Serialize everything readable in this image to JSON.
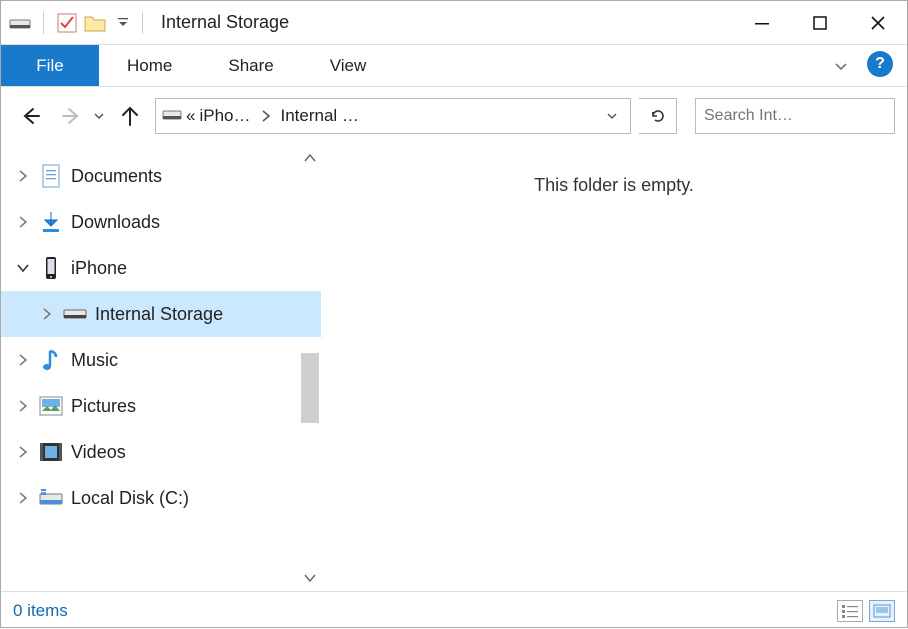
{
  "title": "Internal Storage",
  "ribbon": {
    "file": "File",
    "tabs": [
      "Home",
      "Share",
      "View"
    ]
  },
  "address": {
    "root_symbol": "«",
    "crumbs": [
      "iPho…",
      "Internal …"
    ]
  },
  "search": {
    "placeholder": "Search Int…"
  },
  "tree": [
    {
      "label": "Documents",
      "icon": "document",
      "expander": ">"
    },
    {
      "label": "Downloads",
      "icon": "download",
      "expander": ">"
    },
    {
      "label": "iPhone",
      "icon": "phone",
      "expander": "v",
      "expanded": true
    },
    {
      "label": "Internal Storage",
      "icon": "drive",
      "expander": ">",
      "child": true,
      "selected": true
    },
    {
      "label": "Music",
      "icon": "music",
      "expander": ">"
    },
    {
      "label": "Pictures",
      "icon": "pictures",
      "expander": ">"
    },
    {
      "label": "Videos",
      "icon": "videos",
      "expander": ">"
    },
    {
      "label": "Local Disk (C:)",
      "icon": "localdisk",
      "expander": ">"
    }
  ],
  "content": {
    "empty_message": "This folder is empty."
  },
  "status": {
    "item_count": "0 items"
  }
}
